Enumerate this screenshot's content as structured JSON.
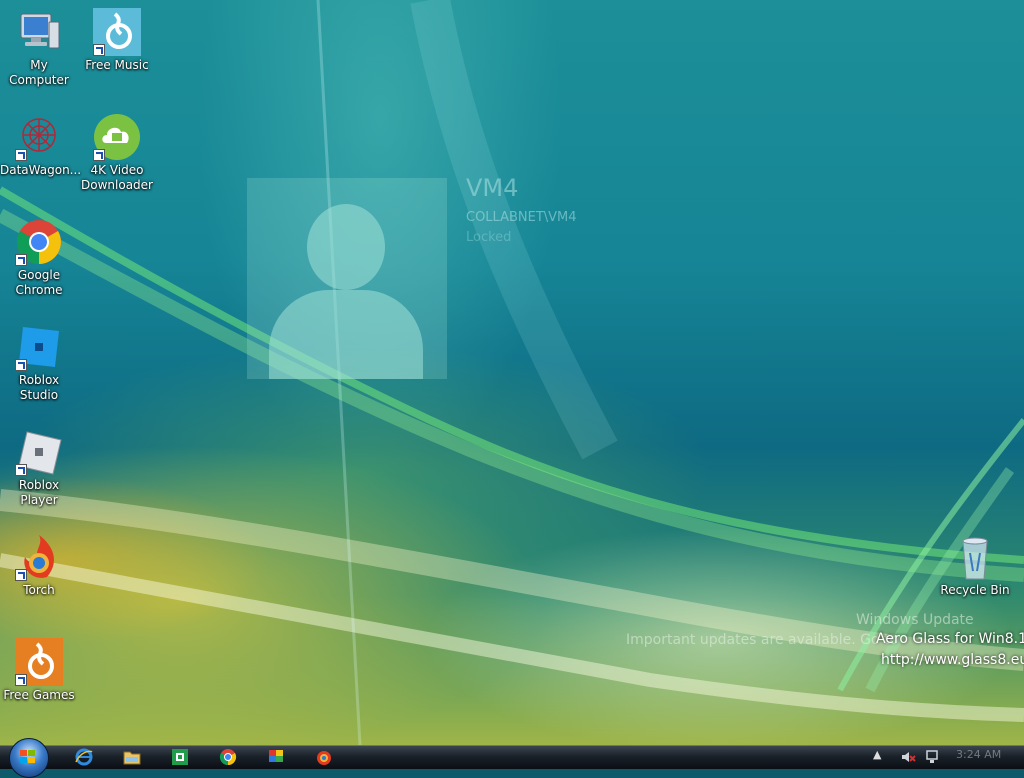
{
  "desktop_icons": [
    {
      "label": "My Computer",
      "icon": "computer-icon"
    },
    {
      "label": "Free Music",
      "icon": "music-icon"
    },
    {
      "label": "DataWagon...",
      "icon": "datawagon-icon"
    },
    {
      "label": "4K Video Downloader",
      "icon": "video-downloader-icon"
    },
    {
      "label": "Google Chrome",
      "icon": "chrome-icon"
    },
    {
      "label": "Roblox Studio",
      "icon": "roblox-studio-icon"
    },
    {
      "label": "Roblox Player",
      "icon": "roblox-player-icon"
    },
    {
      "label": "Torch",
      "icon": "torch-icon"
    },
    {
      "label": "Free Games",
      "icon": "free-games-icon"
    },
    {
      "label": "Recycle Bin",
      "icon": "recycle-bin-icon"
    }
  ],
  "lock_overlay": {
    "user_name": "VM4",
    "domain_user": "COLLABNET\\VM4",
    "status": "Locked"
  },
  "notifications": {
    "windows_update_title": "Windows Update",
    "windows_update_message": "Important updates are available. Go to",
    "aero_glass_title": "Aero Glass for Win8.1",
    "aero_glass_url": "http://www.glass8.eu"
  },
  "taskbar": {
    "pinned": [
      "internet-explorer-icon",
      "folder-icon",
      "green-app-icon",
      "chrome-icon",
      "flag-app-icon",
      "torch-icon"
    ],
    "clock": "3:24 AM"
  },
  "colors": {
    "wallpaper_teal": "#168596",
    "wallpaper_yellow": "#c8b840",
    "taskbar": "#1a2129"
  }
}
